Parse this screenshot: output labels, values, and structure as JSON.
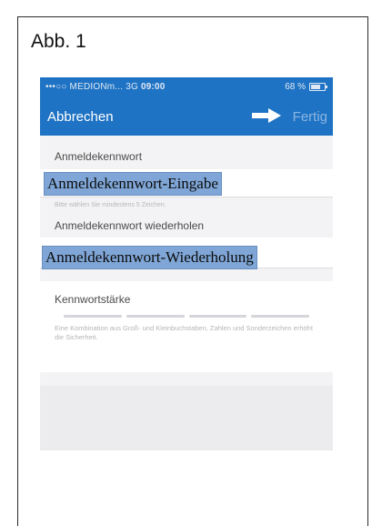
{
  "figure": {
    "label": "Abb. 1"
  },
  "status_bar": {
    "carrier": "•••○○ MEDIONm...",
    "network": "3G",
    "time": "09:00",
    "battery": "68 %"
  },
  "nav": {
    "cancel_label": "Abbrechen",
    "done_label": "Fertig",
    "done_color": "#8bb6e2",
    "bar_color": "#1f73c4"
  },
  "form": {
    "password_title": "Anmeldekennwort",
    "password_hint": "Bitte wählen Sie mindestens 5 Zeichen.",
    "repeat_title": "Anmeldekennwort wiederholen",
    "strength_title": "Kennwortstärke",
    "strength_description": "Eine Kombination aus Groß- und Kleinbuchstaben, Zahlen und Sonderzeichen erhöht die Sicherheit."
  },
  "annotations": {
    "password_input_label": "Anmeldekennwort-Eingabe",
    "password_repeat_label": "Anmeldekennwort-Wiederholung",
    "label_color": "#7fa6d6"
  }
}
